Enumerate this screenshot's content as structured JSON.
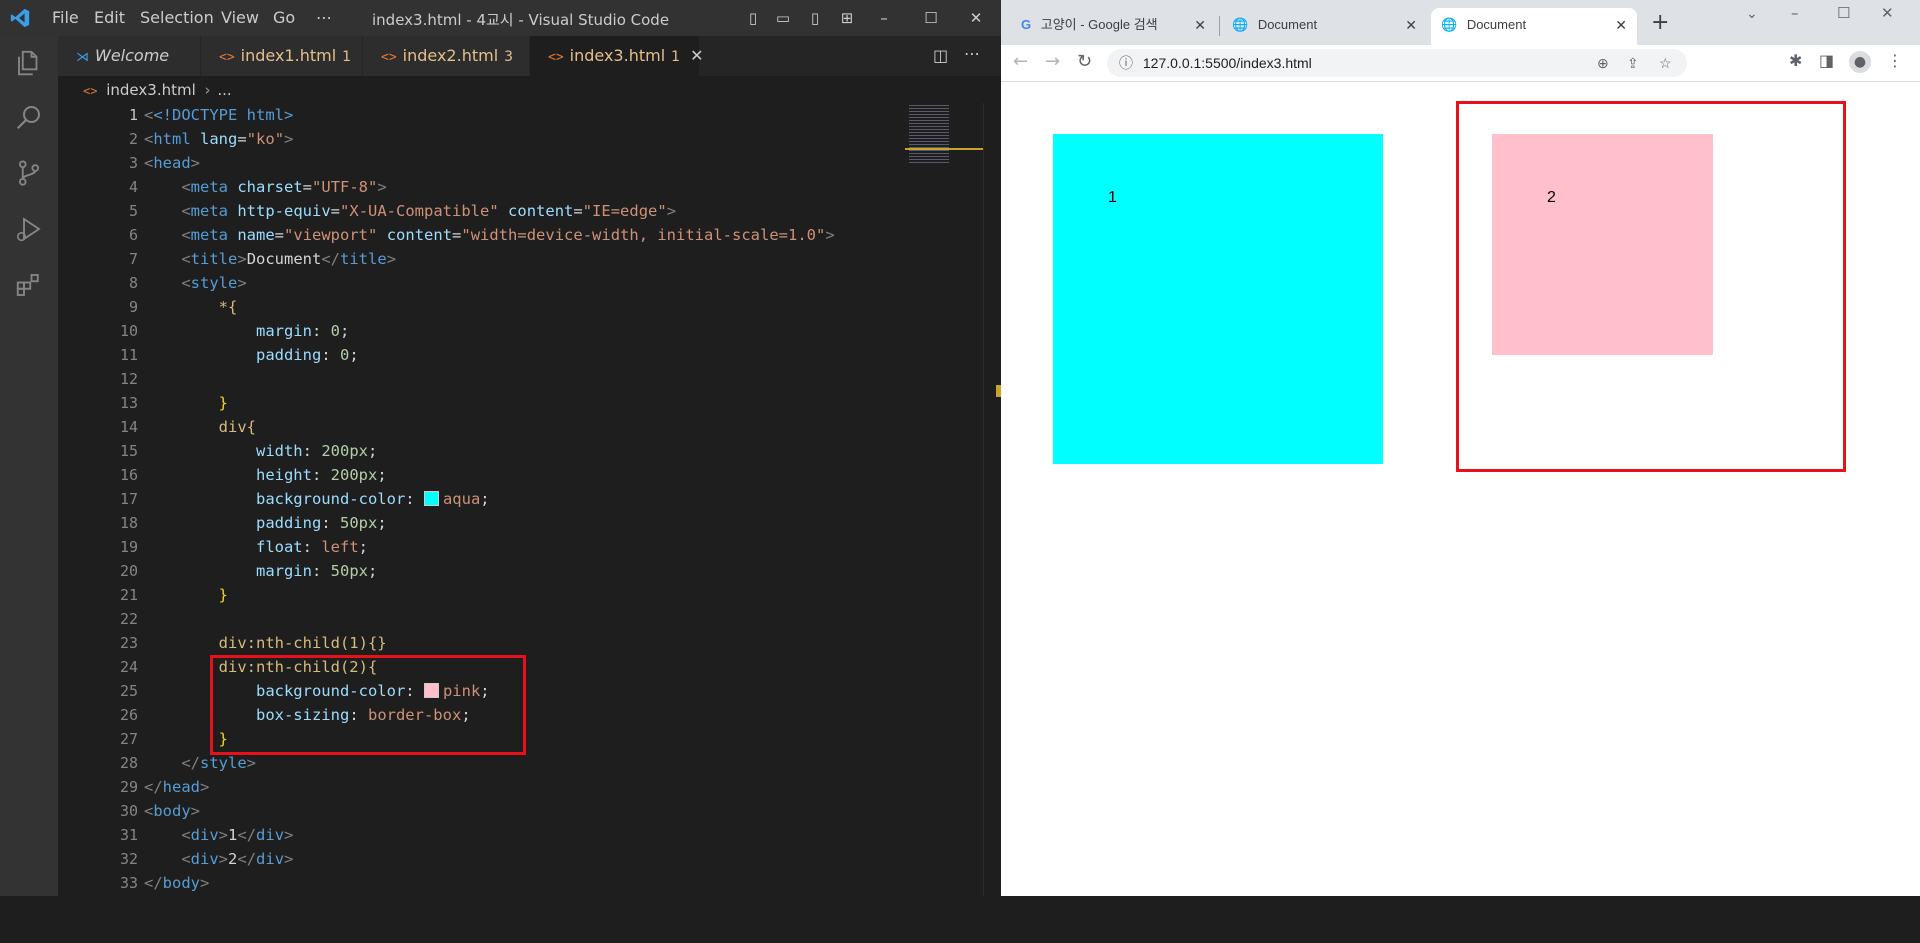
{
  "vscode": {
    "menu": [
      "File",
      "Edit",
      "Selection",
      "View",
      "Go",
      "⋯"
    ],
    "title": "index3.html - 4교시 - Visual Studio Code",
    "tabs": [
      {
        "label": "Welcome",
        "badge": ""
      },
      {
        "label": "index1.html",
        "badge": "1"
      },
      {
        "label": "index2.html",
        "badge": "3"
      },
      {
        "label": "index3.html",
        "badge": "1"
      }
    ],
    "breadcrumb": [
      "index3.html",
      "..."
    ],
    "line_numbers": [
      "1",
      "2",
      "3",
      "4",
      "5",
      "6",
      "7",
      "8",
      "9",
      "10",
      "11",
      "12",
      "13",
      "14",
      "15",
      "16",
      "17",
      "18",
      "19",
      "20",
      "21",
      "22",
      "23",
      "24",
      "25",
      "26",
      "27",
      "28",
      "29",
      "30",
      "31",
      "32",
      "33"
    ],
    "code": {
      "doctype": "<!DOCTYPE html>",
      "html_lang": "ko",
      "meta_charset": "UTF-8",
      "meta_http_equiv": "X-UA-Compatible",
      "meta_content_ie": "IE=edge",
      "meta_name": "viewport",
      "meta_content_vp": "width=device-width, initial-scale=1.0",
      "title": "Document",
      "rule_all_selector": "*{",
      "margin_prop": "margin",
      "margin_val": "0",
      "padding_prop": "padding",
      "padding_val": "0",
      "div_selector": "div{",
      "width_prop": "width",
      "width_val": "200px",
      "height_prop": "height",
      "height_val": "200px",
      "bg_prop": "background-color",
      "bg_val_aqua": "aqua",
      "padding_val2": "50px",
      "float_prop": "float",
      "float_val": "left",
      "margin_val2": "50px",
      "nth1_selector": "div:nth-child(1){}",
      "nth2_selector": "div:nth-child(2){",
      "bg_val_pink": "pink",
      "boxsizing_prop": "box-sizing",
      "boxsizing_val": "border-box",
      "body_div1_text": "1",
      "body_div2_text": "2"
    }
  },
  "browser": {
    "tabs": [
      {
        "label": "고양이 - Google 검색",
        "favicon": "G"
      },
      {
        "label": "Document",
        "favicon": "globe-icon"
      },
      {
        "label": "Document",
        "favicon": "globe-icon"
      }
    ],
    "new_tab_label": "+",
    "url": "127.0.0.1:5500/index3.html",
    "box1_label": "1",
    "box2_label": "2",
    "colors": {
      "aqua": "#00ffff",
      "pink": "#ffc0cb",
      "highlight": "#e8101a"
    }
  }
}
